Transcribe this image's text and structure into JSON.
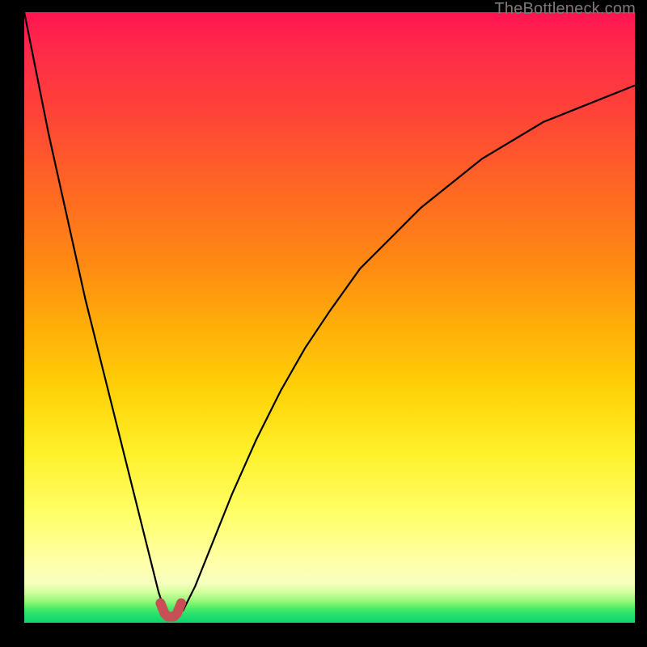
{
  "watermark": {
    "text": "TheBottleneck.com"
  },
  "colors": {
    "curve_stroke": "#000000",
    "marker_stroke": "#c94f57",
    "marker_fill_alpha": "rgba(201,79,87,0.0)"
  },
  "chart_data": {
    "type": "line",
    "title": "",
    "xlabel": "",
    "ylabel": "",
    "xlim": [
      0,
      100
    ],
    "ylim": [
      0,
      100
    ],
    "series": [
      {
        "name": "bottleneck-curve",
        "x": [
          0,
          2,
          4,
          6,
          8,
          10,
          12,
          14,
          16,
          18,
          20,
          21,
          22,
          23,
          24,
          25,
          26,
          28,
          30,
          34,
          38,
          42,
          46,
          50,
          55,
          60,
          65,
          70,
          75,
          80,
          85,
          90,
          95,
          100
        ],
        "y": [
          100,
          90,
          80,
          71,
          62,
          53,
          45,
          37,
          29,
          21,
          13,
          9,
          5,
          2,
          1,
          1,
          2,
          6,
          11,
          21,
          30,
          38,
          45,
          51,
          58,
          63,
          68,
          72,
          76,
          79,
          82,
          84,
          86,
          88
        ]
      },
      {
        "name": "minimum-marker",
        "x": [
          22.3,
          23,
          23.5,
          24.5,
          25,
          25.7
        ],
        "y": [
          3.2,
          1.5,
          1,
          1,
          1.5,
          3.2
        ]
      }
    ],
    "annotations": []
  }
}
